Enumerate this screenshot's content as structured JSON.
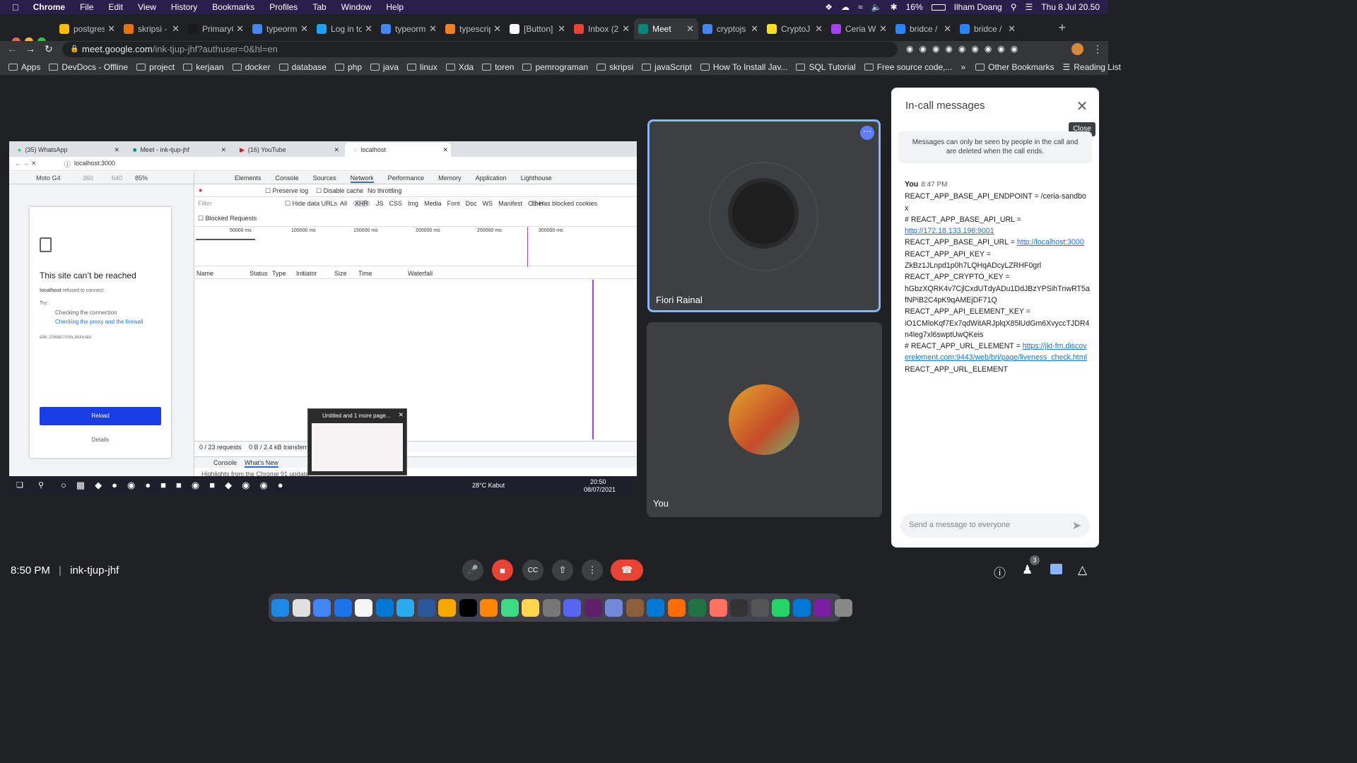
{
  "menubar": {
    "app": "Chrome",
    "items": [
      "File",
      "Edit",
      "View",
      "History",
      "Bookmarks",
      "Profiles",
      "Tab",
      "Window",
      "Help"
    ],
    "battery": "16%",
    "user": "Ilham Doang",
    "datetime": "Thu 8 Jul  20.50"
  },
  "tabs": [
    {
      "label": "postgres",
      "color": "#fbbc05"
    },
    {
      "label": "skripsi -",
      "color": "#e8710a"
    },
    {
      "label": "PrimaryC",
      "color": "#1a1a1a"
    },
    {
      "label": "typeorm",
      "color": "#4285f4"
    },
    {
      "label": "Log in to",
      "color": "#1da1f2"
    },
    {
      "label": "typeorm",
      "color": "#4285f4"
    },
    {
      "label": "typescrip",
      "color": "#f48024"
    },
    {
      "label": "[Button]",
      "color": "#ffffff"
    },
    {
      "label": "Inbox (2",
      "color": "#ea4335"
    },
    {
      "label": "Meet",
      "color": "#00897b"
    },
    {
      "label": "cryptojs",
      "color": "#4285f4"
    },
    {
      "label": "CryptoJ",
      "color": "#f7df1e"
    },
    {
      "label": "Ceria W",
      "color": "#a142f4"
    },
    {
      "label": "bridce /",
      "color": "#2684ff"
    },
    {
      "label": "bridce /",
      "color": "#2684ff"
    }
  ],
  "address": {
    "host": "meet.google.com",
    "path": "/ink-tjup-jhf?authuser=0&hl=en"
  },
  "bookmarks": [
    "Apps",
    "DevDocs - Offline",
    "project",
    "kerjaan",
    "docker",
    "database",
    "php",
    "java",
    "linux",
    "Xda",
    "toren",
    "pemrograman",
    "skripsi",
    "javaScript",
    "How To Install Jav...",
    "SQL Tutorial",
    "Free source code,..."
  ],
  "bookmarks_right": [
    "Other Bookmarks",
    "Reading List"
  ],
  "shared": {
    "tabs": [
      "(35) WhatsApp",
      "Meet - ink-tjup-jhf",
      "(16) YouTube",
      "localhost"
    ],
    "url": "localhost:3000",
    "device": "Moto G4",
    "width": "360",
    "height": "640",
    "zoom": "85%",
    "error_title": "This site can’t be reached",
    "error_host": "localhost",
    "error_msg": "refused to connect.",
    "try": "Try:",
    "suggest1": "Checking the connection",
    "suggest2": "Checking the proxy and the firewall",
    "error_code": "ERR_CONNECTION_REFUSED",
    "reload": "Reload",
    "details": "Details",
    "dt_tabs": [
      "Elements",
      "Console",
      "Sources",
      "Network",
      "Performance",
      "Memory",
      "Application",
      "Lighthouse"
    ],
    "preserve": "Preserve log",
    "disable_cache": "Disable cache",
    "throttle": "No throttling",
    "filter": "Filter",
    "hide_urls": "Hide data URLs",
    "types": [
      "All",
      "XHR",
      "JS",
      "CSS",
      "Img",
      "Media",
      "Font",
      "Doc",
      "WS",
      "Manifest",
      "Other"
    ],
    "blocked_cookies": "Has blocked cookies",
    "blocked_req": "Blocked Requests",
    "ticks": [
      "50000 ms",
      "100000 ms",
      "150000 ms",
      "200000 ms",
      "250000 ms",
      "300000 ms"
    ],
    "cols": [
      "Name",
      "Status",
      "Type",
      "Initiator",
      "Size",
      "Time",
      "Waterfall"
    ],
    "status": "0 / 23 requests",
    "transferred": "0 B / 2.4 kB transferred",
    "drawer": [
      "Console",
      "What's New"
    ],
    "drawer_text": "Highlights from the Chrome 91 update",
    "popup": "Untitled and 1 more page...",
    "weather": "28°C  Kabut",
    "time": "20:50",
    "date": "08/07/2021"
  },
  "participants": [
    {
      "name": "Fiori Rainal"
    },
    {
      "name": "You"
    }
  ],
  "chat": {
    "title": "In-call messages",
    "close_tip": "Close",
    "notice": "Messages can only be seen by people in the call and are deleted when the call ends.",
    "sender": "You",
    "time": "8:47 PM",
    "l1": "REACT_APP_BASE_API_ENDPOINT = /ceria-sandbox",
    "l2": "# REACT_APP_BASE_API_URL =",
    "l2link": "http://172.18.133.198:9001",
    "l3": "REACT_APP_BASE_API_URL = ",
    "l3link": "http://localhost:3000",
    "l4": "REACT_APP_API_KEY =",
    "l5": "ZkBz1JLnpd1p0h7LQHqADcyLZRHF0grl",
    "l6": "REACT_APP_CRYPTO_KEY =",
    "l7": "hGbzXQRK4v7CjlCxdUTdyADu1DdJBzYPSihTnwRT5afNPiB2C4pK9qAMEjDF71Q",
    "l8": "REACT_APP_API_ELEMENT_KEY =",
    "l9": "iO1CMloKqf7Ex7qdWitARJplqX85lUdGm6XvyccTJDR4n4leg7xl6swptUwQKeis",
    "l10": "# REACT_APP_URL_ELEMENT = ",
    "l10link": "https://jkt-fm.discoverelement.com:9443/web/bri/page/liveness_check.html",
    "l11": "REACT_APP_URL_ELEMENT",
    "placeholder": "Send a message to everyone"
  },
  "meeting": {
    "time": "8:50 PM",
    "code": "ink-tjup-jhf",
    "people_count": "3"
  }
}
